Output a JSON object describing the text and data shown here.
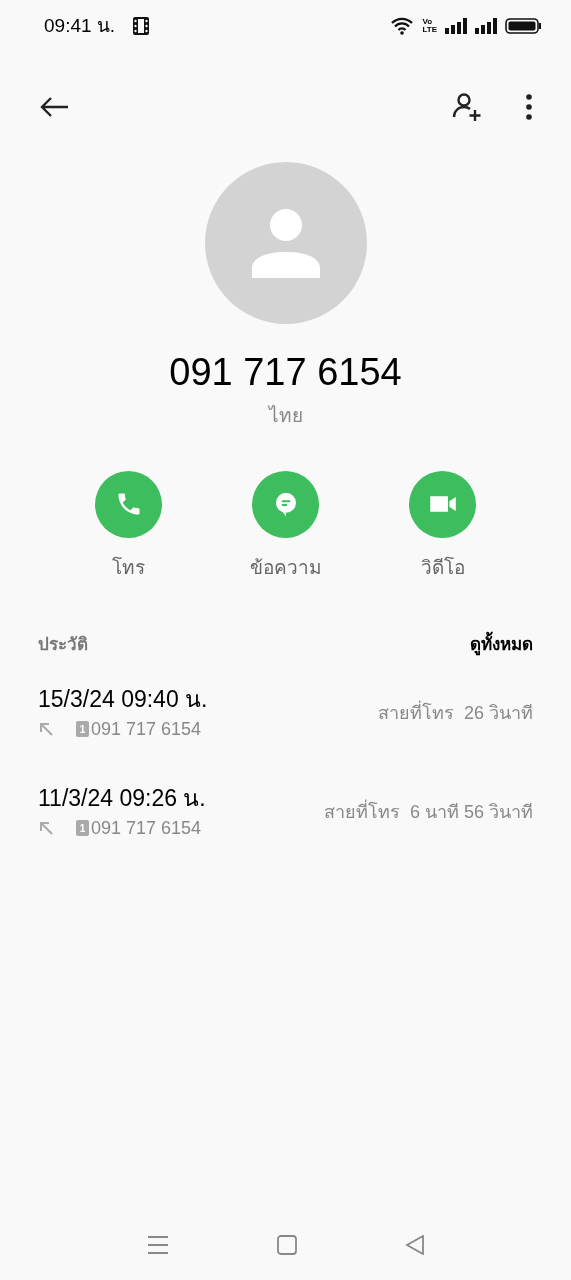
{
  "status_bar": {
    "time": "09:41 น.",
    "volte": "Vo\nLTE"
  },
  "contact": {
    "number": "091 717 6154",
    "location": "ไทย"
  },
  "actions": [
    {
      "kind": "call",
      "label": "โทร"
    },
    {
      "kind": "message",
      "label": "ข้อความ"
    },
    {
      "kind": "video",
      "label": "วิดีโอ"
    }
  ],
  "history": {
    "title": "ประวัติ",
    "see_all": "ดูทั้งหมด",
    "calls": [
      {
        "datetime": "15/3/24 09:40 น.",
        "sim": "1",
        "number": "091 717 6154",
        "duration": "สายที่โทร  26 วินาที"
      },
      {
        "datetime": "11/3/24 09:26 น.",
        "sim": "1",
        "number": "091 717 6154",
        "duration": "สายที่โทร  6 นาที 56 วินาที"
      }
    ]
  }
}
